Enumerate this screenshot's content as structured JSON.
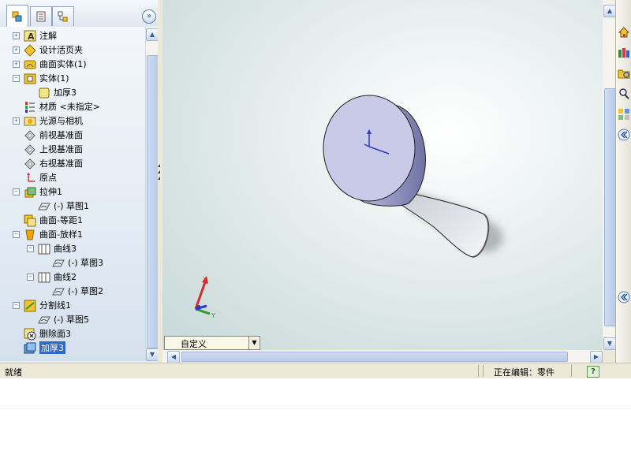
{
  "tabs": [
    {
      "name": "feature-manager-tab",
      "icon": "feature-tree-icon"
    },
    {
      "name": "property-manager-tab",
      "icon": "property-sheet-icon"
    },
    {
      "name": "configuration-manager-tab",
      "icon": "configuration-icon"
    }
  ],
  "collapse_glyph": "»",
  "tree": [
    {
      "label": "注解",
      "level": 0,
      "expander": "+",
      "icon": "annotation-icon"
    },
    {
      "label": "设计活页夹",
      "level": 0,
      "expander": "+",
      "icon": "design-binder-icon"
    },
    {
      "label": "曲面实体(1)",
      "level": 0,
      "expander": "+",
      "icon": "surface-bodies-icon"
    },
    {
      "label": "实体(1)",
      "level": 0,
      "expander": "−",
      "icon": "solid-bodies-icon"
    },
    {
      "label": "加厚3",
      "level": 1,
      "expander": "",
      "icon": "body-icon"
    },
    {
      "label": "材质 <未指定>",
      "level": 0,
      "expander": "",
      "icon": "material-icon"
    },
    {
      "label": "光源与相机",
      "level": 0,
      "expander": "+",
      "icon": "lights-camera-icon"
    },
    {
      "label": "前视基准面",
      "level": 0,
      "expander": "",
      "icon": "plane-icon"
    },
    {
      "label": "上视基准面",
      "level": 0,
      "expander": "",
      "icon": "plane-icon"
    },
    {
      "label": "右视基准面",
      "level": 0,
      "expander": "",
      "icon": "plane-icon"
    },
    {
      "label": "原点",
      "level": 0,
      "expander": "",
      "icon": "origin-icon"
    },
    {
      "label": "拉伸1",
      "level": 0,
      "expander": "−",
      "icon": "extrude-icon"
    },
    {
      "label": "(-) 草图1",
      "level": 1,
      "expander": "",
      "icon": "sketch-icon"
    },
    {
      "label": "曲面-等距1",
      "level": 0,
      "expander": "",
      "icon": "surface-offset-icon"
    },
    {
      "label": "曲面-放样1",
      "level": 0,
      "expander": "−",
      "icon": "surface-loft-icon"
    },
    {
      "label": "曲线3",
      "level": 1,
      "expander": "−",
      "icon": "curve-icon"
    },
    {
      "label": "(-) 草图3",
      "level": 2,
      "expander": "",
      "icon": "sketch-icon"
    },
    {
      "label": "曲线2",
      "level": 1,
      "expander": "−",
      "icon": "curve-icon"
    },
    {
      "label": "(-) 草图2",
      "level": 2,
      "expander": "",
      "icon": "sketch-icon"
    },
    {
      "label": "分割线1",
      "level": 0,
      "expander": "−",
      "icon": "split-line-icon"
    },
    {
      "label": "(-) 草图5",
      "level": 1,
      "expander": "",
      "icon": "sketch-icon"
    },
    {
      "label": "删除面3",
      "level": 0,
      "expander": "",
      "icon": "delete-face-icon"
    },
    {
      "label": "加厚3",
      "level": 0,
      "expander": "",
      "icon": "thicken-icon",
      "selected": true
    }
  ],
  "view_combo": "自定义",
  "triad": {
    "x": "X",
    "y": "Y"
  },
  "status": {
    "left": "就绪",
    "editing": "正在编辑：零件",
    "help": "?"
  },
  "colors": {
    "accent": "#3169c6",
    "model_face": "#c8cae8",
    "model_side": "#8c8eb8"
  },
  "task_pane_icons": [
    "home-icon",
    "design-library-icon",
    "file-explorer-icon",
    "search-icon",
    "view-palette-icon",
    "collapse-icon"
  ]
}
